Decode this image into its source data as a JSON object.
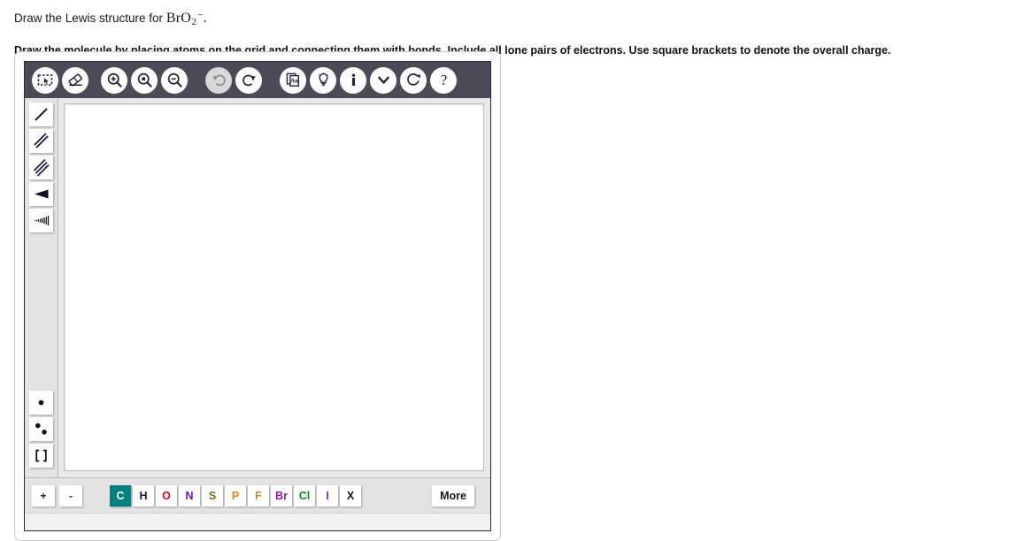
{
  "question": {
    "prompt_prefix": "Draw the Lewis structure for",
    "formula": {
      "element1": "Br",
      "element2": "O",
      "subscript": "2",
      "charge": "−",
      "period": "."
    },
    "instructions": "Draw the molecule by placing atoms on the grid and connecting them with bonds. Include all lone pairs of electrons. Use square brackets to denote the overall charge."
  },
  "editor": {
    "toolbar": {
      "buttons": [
        {
          "name": "select-tool",
          "icon": "select-marquee-icon",
          "label": "Select",
          "disabled": false
        },
        {
          "name": "erase-tool",
          "icon": "eraser-icon",
          "label": "Erase",
          "disabled": false
        },
        {
          "name": "zoom-in-tool",
          "icon": "zoom-in-icon",
          "label": "Zoom In",
          "disabled": false
        },
        {
          "name": "zoom-fit-tool",
          "icon": "zoom-fit-icon",
          "label": "Zoom to Fit",
          "disabled": false
        },
        {
          "name": "zoom-out-tool",
          "icon": "zoom-out-icon",
          "label": "Zoom Out",
          "disabled": false
        },
        {
          "name": "undo-button",
          "icon": "undo-arrow-icon",
          "label": "Undo",
          "disabled": true
        },
        {
          "name": "redo-button",
          "icon": "redo-arrow-icon",
          "label": "Redo",
          "disabled": false
        },
        {
          "name": "template-button",
          "icon": "document-text-icon",
          "label": "Templates",
          "disabled": false
        },
        {
          "name": "hint-button",
          "icon": "lightbulb-icon",
          "label": "Hint",
          "disabled": false
        },
        {
          "name": "info-button",
          "icon": "info-icon",
          "label": "Info",
          "disabled": false
        },
        {
          "name": "dropdown-button",
          "icon": "chevron-down-icon",
          "label": "More Options",
          "disabled": false
        },
        {
          "name": "reset-button",
          "icon": "refresh-icon",
          "label": "Reset",
          "disabled": false
        },
        {
          "name": "help-button",
          "icon": "question-mark-icon",
          "label": "Help",
          "disabled": false
        }
      ]
    },
    "bond_tools": [
      {
        "name": "single-bond-tool",
        "icon": "single-bond-icon",
        "label": "Single Bond"
      },
      {
        "name": "double-bond-tool",
        "icon": "double-bond-icon",
        "label": "Double Bond"
      },
      {
        "name": "triple-bond-tool",
        "icon": "triple-bond-icon",
        "label": "Triple Bond"
      },
      {
        "name": "wedge-bond-tool",
        "icon": "wedge-bond-icon",
        "label": "Wedge Bond"
      },
      {
        "name": "hash-bond-tool",
        "icon": "hash-bond-icon",
        "label": "Hash Bond"
      }
    ],
    "electron_tools": [
      {
        "name": "single-electron-tool",
        "icon": "single-dot-icon",
        "label": "Single Electron"
      },
      {
        "name": "lone-pair-tool",
        "icon": "two-dots-icon",
        "label": "Lone Pair"
      },
      {
        "name": "brackets-tool",
        "icon": "brackets-icon",
        "label": "Brackets"
      }
    ],
    "charge_buttons": [
      {
        "name": "increase-charge-button",
        "label": "+"
      },
      {
        "name": "decrease-charge-button",
        "label": "-"
      }
    ],
    "elements": [
      {
        "symbol": "C",
        "color": "#ffffff",
        "selected": true
      },
      {
        "symbol": "H",
        "color": "#16184a",
        "selected": false
      },
      {
        "symbol": "O",
        "color": "#e8000d",
        "selected": false
      },
      {
        "symbol": "N",
        "color": "#6a11c6",
        "selected": false
      },
      {
        "symbol": "S",
        "color": "#7d7016",
        "selected": false
      },
      {
        "symbol": "P",
        "color": "#d98c12",
        "selected": false
      },
      {
        "symbol": "F",
        "color": "#b8912e",
        "selected": false
      },
      {
        "symbol": "Br",
        "color": "#8e1f8e",
        "selected": false
      },
      {
        "symbol": "Cl",
        "color": "#118a26",
        "selected": false
      },
      {
        "symbol": "I",
        "color": "#7a2fd1",
        "selected": false
      },
      {
        "symbol": "X",
        "color": "#121212",
        "selected": false
      }
    ],
    "more_label": "More",
    "canvas_label": "Drawing canvas"
  }
}
